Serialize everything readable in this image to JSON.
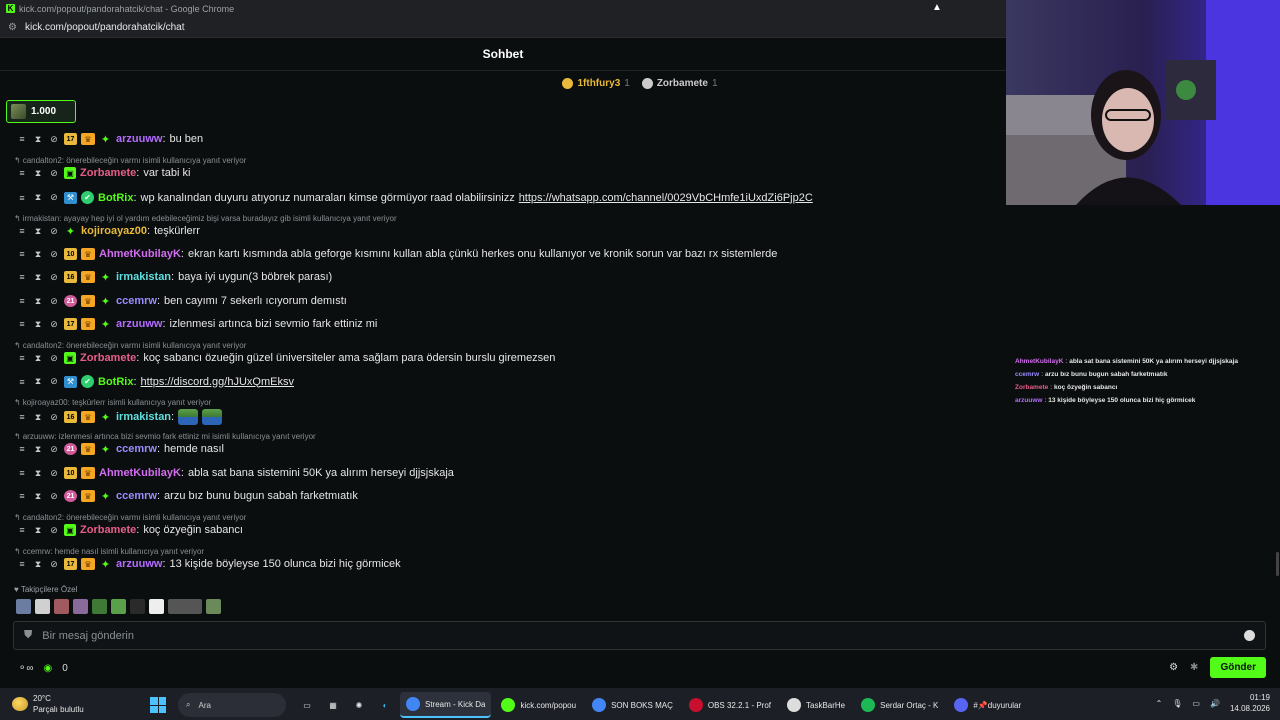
{
  "window": {
    "title": "kick.com/popout/pandorahatcik/chat - Google Chrome",
    "url": "kick.com/popout/pandorahatcik/chat"
  },
  "chat": {
    "header": "Sohbet",
    "gifters": [
      {
        "name": "1fthfury3",
        "count": "1",
        "color": "#e8b93a"
      },
      {
        "name": "Zorbamete",
        "count": "1",
        "color": "#cccccc"
      }
    ],
    "pinned_amount": "1.000",
    "messages": [
      {
        "reply": "",
        "badge": "17",
        "user": "arzuuww",
        "color": "#b46cff",
        "text": "bu ben",
        "kind": "sub"
      },
      {
        "reply": "candalton2: önerebileceğin varmı isimli kullanıcıya yanıt veriyor",
        "badge": "",
        "user": "Zorbamete",
        "color": "#e85d8a",
        "text": "var tabi ki",
        "kind": "gift"
      },
      {
        "reply": "",
        "badge": "",
        "user": "BotRix",
        "color": "#53fc18",
        "text": "wp kanalından duyuru atıyoruz numaraları kimse görmüyor raad olabilirsinizz",
        "link": "https://whatsapp.com/channel/0029VbCHmfe1iUxdZi6Pjp2C",
        "kind": "bot"
      },
      {
        "reply": "irmakistan: ayayay hep iyi ol yardım edebileceğimiz bişi varsa buradayız gib isimli kullanıcıya yanıt veriyor",
        "badge": "",
        "user": "kojiroayaz00",
        "color": "#e8b93a",
        "text": "teşkürlerr",
        "kind": "plain"
      },
      {
        "reply": "",
        "badge": "10",
        "user": "AhmetKubilayK",
        "color": "#d36cf0",
        "text": "ekran kartı kısmında abla geforge kısmını kullan abla çünkü herkes onu kullanıyor ve kronik sorun var bazı rx sistemlerde",
        "kind": "num"
      },
      {
        "reply": "",
        "badge": "16",
        "user": "irmakistan",
        "color": "#5ee0e0",
        "text": "baya iyi uygun(3 böbrek parası)",
        "kind": "sub"
      },
      {
        "reply": "",
        "badge": "21",
        "user": "ccemrw",
        "color": "#9b8cff",
        "text": "ben cayımı 7 sekerlı ıcıyorum demıstı",
        "kind": "subpink"
      },
      {
        "reply": "",
        "badge": "17",
        "user": "arzuuww",
        "color": "#b46cff",
        "text": "izlenmesi artınca bizi sevmio fark ettiniz mi",
        "kind": "sub"
      },
      {
        "reply": "candalton2: önerebileceğin varmı isimli kullanıcıya yanıt veriyor",
        "badge": "",
        "user": "Zorbamete",
        "color": "#e85d8a",
        "text": "koç sabancı özueğin güzel üniversiteler ama sağlam para ödersin burslu giremezsen",
        "kind": "gift"
      },
      {
        "reply": "",
        "badge": "",
        "user": "BotRix",
        "color": "#53fc18",
        "text": "",
        "link": "https://discord.gg/hJUxQmEksv",
        "kind": "bot"
      },
      {
        "reply": "kojiroayaz00: teşkürlerr isimli kullanıcıya yanıt veriyor",
        "badge": "16",
        "user": "irmakistan",
        "color": "#5ee0e0",
        "text": "",
        "kind": "sub",
        "emotes": 2
      },
      {
        "reply": "arzuuww: izlenmesi artınca bizi sevmio fark ettiniz mi isimli kullanıcıya yanıt veriyor",
        "badge": "21",
        "user": "ccemrw",
        "color": "#9b8cff",
        "text": "hemde nasıl",
        "kind": "subpink"
      },
      {
        "reply": "",
        "badge": "10",
        "user": "AhmetKubilayK",
        "color": "#d36cf0",
        "text": "abla sat bana sistemini 50K ya alırım herseyi djjsjskaja",
        "kind": "num"
      },
      {
        "reply": "",
        "badge": "21",
        "user": "ccemrw",
        "color": "#9b8cff",
        "text": "arzu bız bunu bugun sabah farketmıatık",
        "kind": "subpink"
      },
      {
        "reply": "candalton2: önerebileceğin varmı isimli kullanıcıya yanıt veriyor",
        "badge": "",
        "user": "Zorbamete",
        "color": "#e85d8a",
        "text": "koç özyeğin sabancı",
        "kind": "gift"
      },
      {
        "reply": "ccemrw: hemde nasıl isimli kullanıcıya yanıt veriyor",
        "badge": "17",
        "user": "arzuuww",
        "color": "#b46cff",
        "text": "13 kişide böyleyse 150 olunca bizi hiç görmicek",
        "kind": "sub"
      }
    ],
    "followers_label": "Takipçilere Özel",
    "input_placeholder": "Bir mesaj gönderin",
    "points": "0",
    "send_label": "Gönder"
  },
  "overlay": [
    {
      "user": "AhmetKubilayK",
      "text": "abla sat bana sistemini 50K ya alırım herseyi djjsjskaja",
      "color": "#d36cf0"
    },
    {
      "user": "ccemrw",
      "text": "arzu bız bunu bugun sabah farketmıatık",
      "color": "#9b8cff"
    },
    {
      "user": "Zorbamete",
      "text": "koç özyeğin sabancı",
      "color": "#e85d8a"
    },
    {
      "user": "arzuuww",
      "text": "13 kişide böyleyse 150 olunca bizi hiç görmicek",
      "color": "#b46cff"
    }
  ],
  "taskbar": {
    "weather_temp": "20°C",
    "weather_desc": "Parçalı bulutlu",
    "search": "Ara",
    "apps": [
      {
        "label": "Stream - Kick Da",
        "color": "#4285f4",
        "active": true
      },
      {
        "label": "kick.com/popou",
        "color": "#53fc18",
        "active": false
      },
      {
        "label": "SON BOKS MAÇ",
        "color": "#4285f4",
        "active": false
      },
      {
        "label": "OBS 32.2.1 - Prof",
        "color": "#c8102e",
        "active": false
      },
      {
        "label": "TaskBarHe",
        "color": "#dddddd",
        "active": false
      },
      {
        "label": "Serdar Ortaç - K",
        "color": "#1db954",
        "active": false
      },
      {
        "label": "#📌duyurular",
        "color": "#5865f2",
        "active": false
      }
    ],
    "time": "01:19",
    "date": "14.08.2026"
  }
}
